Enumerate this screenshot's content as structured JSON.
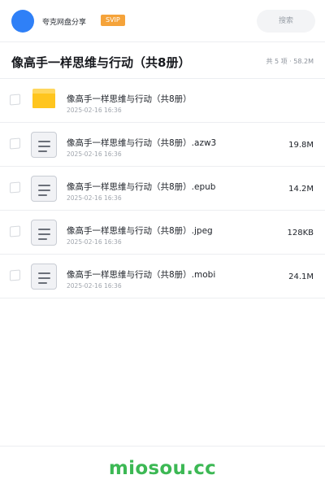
{
  "header": {
    "username": "夸克网盘分享",
    "badge": "SVIP",
    "search_placeholder": "搜索",
    "accent_color": "#2f80f7",
    "badge_color": "#f5a33a"
  },
  "title_bar": {
    "title": "像高手一样思维与行动（共8册）",
    "summary": "共 5 项 · 58.2M"
  },
  "files": [
    {
      "icon": "folder-icon",
      "name": "像高手一样思维与行动（共8册）",
      "date": "2025-02-16 16:36",
      "size": ""
    },
    {
      "icon": "document-icon",
      "name": "像高手一样思维与行动（共8册）.azw3",
      "date": "2025-02-16 16:36",
      "size": "19.8M"
    },
    {
      "icon": "document-icon",
      "name": "像高手一样思维与行动（共8册）.epub",
      "date": "2025-02-16 16:36",
      "size": "14.2M"
    },
    {
      "icon": "document-icon",
      "name": "像高手一样思维与行动（共8册）.jpeg",
      "date": "2025-02-16 16:36",
      "size": "128KB"
    },
    {
      "icon": "document-icon",
      "name": "像高手一样思维与行动（共8册）.mobi",
      "date": "2025-02-16 16:36",
      "size": "24.1M"
    }
  ],
  "footer": {
    "watermark": "miosou.cc",
    "watermark_color": "#3cb854"
  }
}
